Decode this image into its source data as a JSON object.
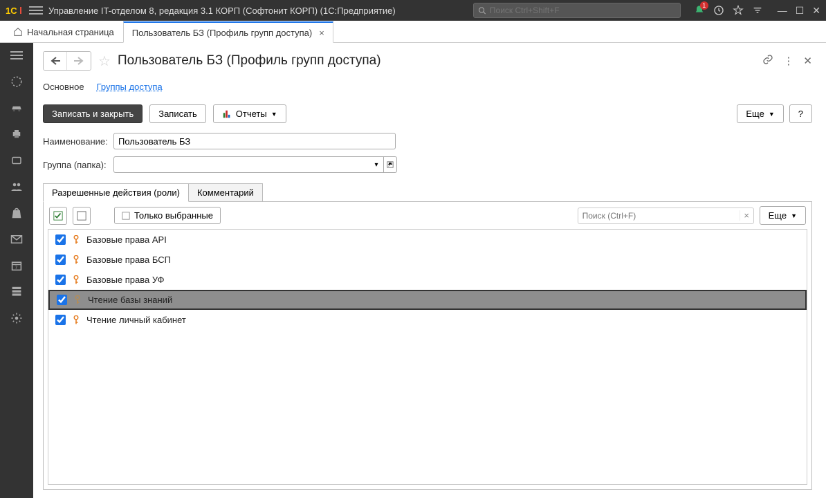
{
  "titlebar": {
    "app_title": "Управление IT-отделом 8, редакция 3.1 КОРП (Софтонит КОРП)  (1С:Предприятие)",
    "search_placeholder": "Поиск Ctrl+Shift+F",
    "bell_badge": "1"
  },
  "tabs": {
    "home": "Начальная страница",
    "active": "Пользователь БЗ (Профиль групп доступа)"
  },
  "page": {
    "title": "Пользователь БЗ (Профиль групп доступа)"
  },
  "section_tabs": {
    "main": "Основное",
    "groups": "Группы доступа"
  },
  "toolbar": {
    "save_close": "Записать и закрыть",
    "save": "Записать",
    "reports": "Отчеты",
    "more": "Еще",
    "help": "?"
  },
  "form": {
    "name_label": "Наименование:",
    "name_value": "Пользователь БЗ",
    "group_label": "Группа (папка):",
    "group_value": ""
  },
  "roles_tabs": {
    "roles": "Разрешенные действия (роли)",
    "comment": "Комментарий"
  },
  "roles_toolbar": {
    "only_selected": "Только выбранные",
    "search_placeholder": "Поиск (Ctrl+F)",
    "more": "Еще"
  },
  "roles": [
    {
      "label": "Базовые права API",
      "checked": true,
      "key": "orange",
      "selected": false
    },
    {
      "label": "Базовые права БСП",
      "checked": true,
      "key": "orange",
      "selected": false
    },
    {
      "label": "Базовые права УФ",
      "checked": true,
      "key": "orange",
      "selected": false
    },
    {
      "label": "Чтение базы знаний",
      "checked": true,
      "key": "blue",
      "selected": true
    },
    {
      "label": "Чтение личный кабинет",
      "checked": true,
      "key": "orange",
      "selected": false
    }
  ]
}
